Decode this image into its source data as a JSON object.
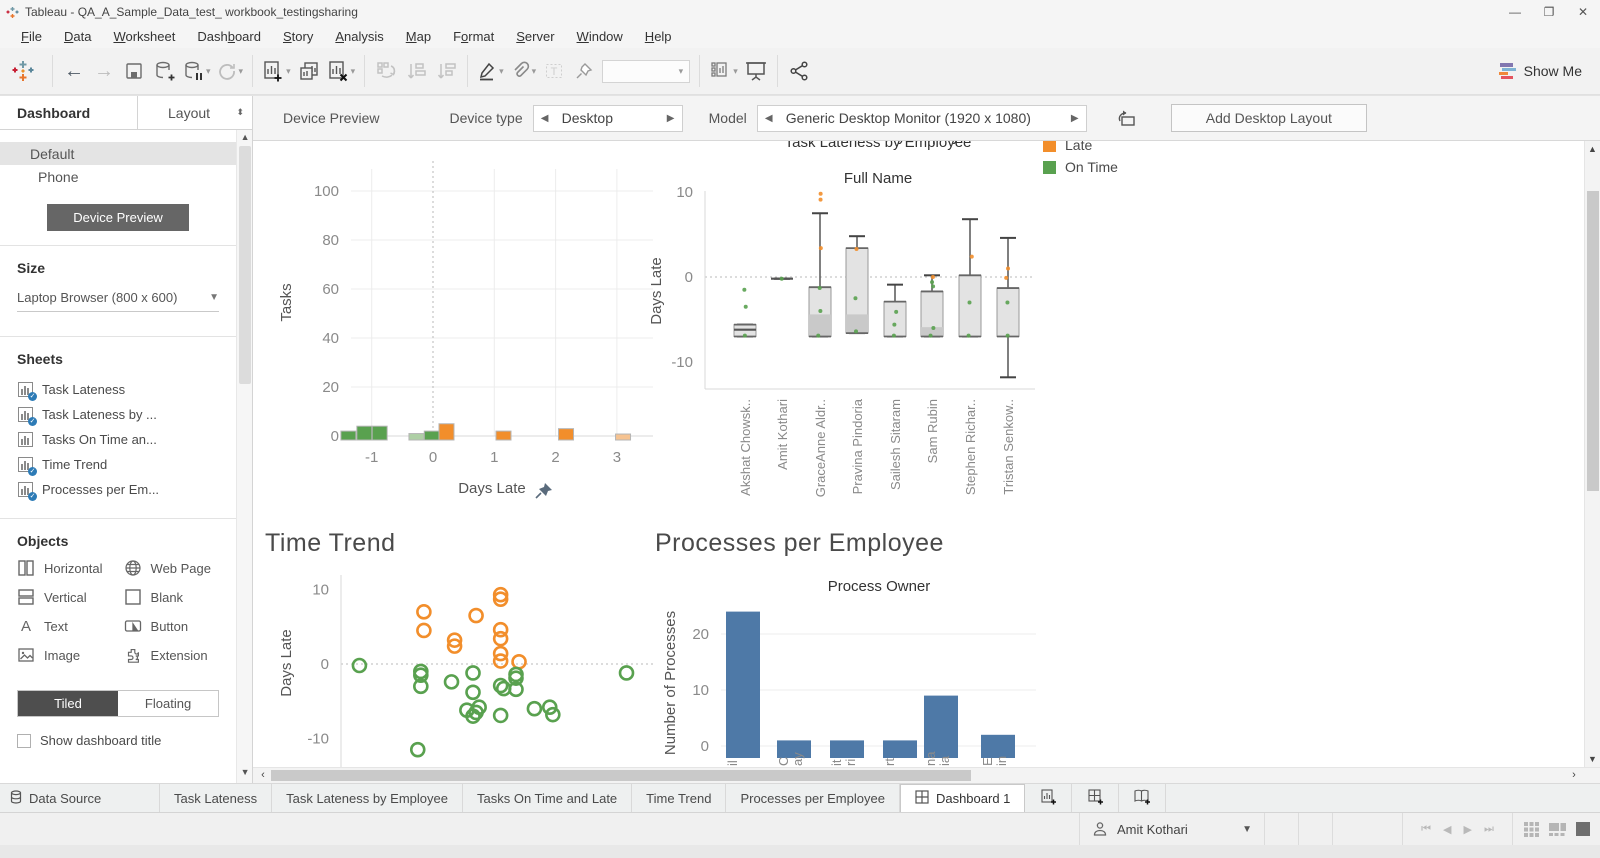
{
  "window": {
    "title": "Tableau - QA_A_Sample_Data_test_ workbook_testingsharing",
    "controls": [
      "minimize",
      "maximize",
      "close"
    ]
  },
  "menu": {
    "items": [
      {
        "label": "File",
        "u": 0
      },
      {
        "label": "Data",
        "u": 0
      },
      {
        "label": "Worksheet",
        "u": 0
      },
      {
        "label": "Dashboard",
        "u": 4
      },
      {
        "label": "Story",
        "u": 0
      },
      {
        "label": "Analysis",
        "u": 0
      },
      {
        "label": "Map",
        "u": 0
      },
      {
        "label": "Format",
        "u": 1
      },
      {
        "label": "Server",
        "u": 0
      },
      {
        "label": "Window",
        "u": 0
      },
      {
        "label": "Help",
        "u": 0
      }
    ]
  },
  "toolbar": {
    "show_me_label": "Show Me"
  },
  "sidebar": {
    "tabs": {
      "dashboard": "Dashboard",
      "layout": "Layout"
    },
    "device_list": [
      {
        "label": "Default",
        "selected": true
      },
      {
        "label": "Phone",
        "selected": false
      }
    ],
    "device_preview_button": "Device Preview",
    "size": {
      "label": "Size",
      "value": "Laptop Browser (800 x 600)"
    },
    "sheets": {
      "label": "Sheets",
      "items": [
        {
          "label": "Task Lateness",
          "in_dashboard": true
        },
        {
          "label": "Task Lateness by ...",
          "in_dashboard": true
        },
        {
          "label": "Tasks On Time an...",
          "in_dashboard": false
        },
        {
          "label": "Time Trend",
          "in_dashboard": true
        },
        {
          "label": "Processes per Em...",
          "in_dashboard": true
        }
      ]
    },
    "objects": {
      "label": "Objects",
      "items": [
        {
          "label": "Horizontal",
          "icon": "horizontal-icon"
        },
        {
          "label": "Web Page",
          "icon": "web-page-icon"
        },
        {
          "label": "Vertical",
          "icon": "vertical-icon"
        },
        {
          "label": "Blank",
          "icon": "blank-icon"
        },
        {
          "label": "Text",
          "icon": "text-icon"
        },
        {
          "label": "Button",
          "icon": "button-icon"
        },
        {
          "label": "Image",
          "icon": "image-icon"
        },
        {
          "label": "Extension",
          "icon": "extension-icon"
        }
      ]
    },
    "layout_mode": {
      "tiled": "Tiled",
      "floating": "Floating",
      "active": "Tiled"
    },
    "show_dashboard_title": {
      "label": "Show dashboard title",
      "checked": false
    }
  },
  "devicebar": {
    "preview_label": "Device Preview",
    "device_type_label": "Device type",
    "device_type_value": "Desktop",
    "model_label": "Model",
    "model_value": "Generic Desktop Monitor (1920 x 1080)",
    "add_layout_button": "Add Desktop Layout"
  },
  "legend": {
    "items": [
      {
        "label": "Late",
        "color": "#f28e2b"
      },
      {
        "label": "On Time",
        "color": "#59a14f"
      }
    ]
  },
  "chart_data": [
    {
      "type": "bar",
      "name": "Tasks On Time and Late",
      "xlabel": "Days Late",
      "ylabel": "Tasks",
      "x_ticks": [
        -1,
        0,
        1,
        2,
        3
      ],
      "y_ticks": [
        0,
        20,
        40,
        60,
        80,
        100
      ],
      "ylim": [
        0,
        110
      ],
      "bars": [
        {
          "x": -1.38,
          "value": 2,
          "color": "#59a14f"
        },
        {
          "x": -1.12,
          "value": 4,
          "color": "#59a14f"
        },
        {
          "x": -0.87,
          "value": 4,
          "color": "#59a14f"
        },
        {
          "x": -0.27,
          "value": 1,
          "color": "#aecfa5"
        },
        {
          "x": -0.02,
          "value": 2,
          "color": "#59a14f"
        },
        {
          "x": 0.22,
          "value": 5,
          "color": "#f28e2b"
        },
        {
          "x": 1.15,
          "value": 2,
          "color": "#f28e2b"
        },
        {
          "x": 2.17,
          "value": 3,
          "color": "#f28e2b"
        },
        {
          "x": 3.1,
          "value": 0.8,
          "color": "#f6c391"
        }
      ]
    },
    {
      "type": "boxplot",
      "name": "Task Lateness by Employee",
      "title_clipped": "Task Lateness by Employee",
      "column_header": "Full Name",
      "ylabel": "Days Late",
      "y_ticks": [
        10,
        0,
        -10
      ],
      "categories": [
        "Akshat Chowsk..",
        "Amit Kothari",
        "GraceAnne Aldr..",
        "Pravina Pindoria",
        "Sailesh Sitaram",
        "Sam Rubin",
        "Stephen Richar..",
        "Tristan Senkow.."
      ],
      "boxes": [
        {
          "lo": -7,
          "q1": -7,
          "q3": -5.6,
          "hi": -5.6,
          "median": -6.2,
          "points": [
            {
              "v": -1.5,
              "c": "g"
            },
            {
              "v": -3.5,
              "c": "g"
            },
            {
              "v": -6.9,
              "c": "g"
            }
          ]
        },
        {
          "lo": -0.2,
          "q1": -0.2,
          "q3": -0.2,
          "hi": -0.2,
          "median": -0.2,
          "points": [
            {
              "v": -0.2,
              "c": "g"
            }
          ]
        },
        {
          "lo": -7,
          "q1": -7,
          "q3": -1.2,
          "hi": 7.5,
          "shade": [
            -4.4,
            -7
          ],
          "points": [
            {
              "v": 9.8,
              "c": "o"
            },
            {
              "v": 9.1,
              "c": "o"
            },
            {
              "v": 3.4,
              "c": "o"
            },
            {
              "v": -1.3,
              "c": "g"
            },
            {
              "v": -4,
              "c": "g"
            },
            {
              "v": -6.9,
              "c": "g"
            }
          ]
        },
        {
          "lo": -6.6,
          "q1": -6.6,
          "q3": 3.4,
          "hi": 4.8,
          "shade": [
            -4.4,
            -6.6
          ],
          "points": [
            {
              "v": 3.3,
              "c": "o"
            },
            {
              "v": -2.5,
              "c": "g"
            },
            {
              "v": -6.4,
              "c": "g"
            }
          ]
        },
        {
          "lo": -7,
          "q1": -7,
          "q3": -2.9,
          "hi": -0.9,
          "points": [
            {
              "v": -4.1,
              "c": "g"
            },
            {
              "v": -5.6,
              "c": "g"
            },
            {
              "v": -6.9,
              "c": "g"
            }
          ]
        },
        {
          "lo": -7,
          "q1": -7,
          "q3": -1.7,
          "hi": 0.2,
          "shade": [
            -5.9,
            -7
          ],
          "points": [
            {
              "v": 0,
              "c": "o"
            },
            {
              "v": -0.6,
              "c": "g"
            },
            {
              "v": -1.1,
              "c": "g"
            },
            {
              "v": -6,
              "c": "g"
            },
            {
              "v": -6.9,
              "c": "g"
            }
          ]
        },
        {
          "lo": -7,
          "q1": -7,
          "q3": 0.2,
          "hi": 6.8,
          "points": [
            {
              "v": 2.4,
              "c": "o"
            },
            {
              "v": -3,
              "c": "g"
            },
            {
              "v": -6.9,
              "c": "g"
            }
          ]
        },
        {
          "lo": -11.8,
          "q1": -7,
          "q3": -1.3,
          "hi": 4.6,
          "points": [
            {
              "v": 1,
              "c": "o"
            },
            {
              "v": -0.1,
              "c": "o"
            },
            {
              "v": -3,
              "c": "g"
            },
            {
              "v": -6.9,
              "c": "g"
            }
          ]
        }
      ]
    },
    {
      "type": "scatter",
      "name": "Time Trend",
      "title": "Time Trend",
      "ylabel": "Days Late",
      "y_ticks": [
        10,
        0,
        -10
      ],
      "series": [
        {
          "name": "Late",
          "color": "#f28e2b",
          "points": [
            [
              0.27,
              7
            ],
            [
              0.27,
              4.5
            ],
            [
              0.37,
              3.2
            ],
            [
              0.37,
              2.4
            ],
            [
              0.44,
              6.5
            ],
            [
              0.52,
              9.3
            ],
            [
              0.52,
              8.7
            ],
            [
              0.52,
              4.6
            ],
            [
              0.52,
              3.4
            ],
            [
              0.52,
              1.4
            ],
            [
              0.52,
              0.4
            ],
            [
              0.58,
              0.3
            ]
          ]
        },
        {
          "name": "On Time",
          "color": "#59a14f",
          "points": [
            [
              0.06,
              -0.2
            ],
            [
              0.26,
              -1
            ],
            [
              0.26,
              -1.5
            ],
            [
              0.26,
              -3
            ],
            [
              0.36,
              -2.4
            ],
            [
              0.43,
              -1.2
            ],
            [
              0.43,
              -3.8
            ],
            [
              0.41,
              -6.2
            ],
            [
              0.43,
              -7
            ],
            [
              0.45,
              -5.8
            ],
            [
              0.44,
              -6.5
            ],
            [
              0.25,
              -11.5
            ],
            [
              0.52,
              -2.9
            ],
            [
              0.53,
              -3.3
            ],
            [
              0.52,
              -6.9
            ],
            [
              0.57,
              -1.4
            ],
            [
              0.57,
              -1.9
            ],
            [
              0.57,
              -3.4
            ],
            [
              0.63,
              -6
            ],
            [
              0.68,
              -5.8
            ],
            [
              0.69,
              -6.8
            ],
            [
              0.93,
              -1.2
            ]
          ]
        }
      ]
    },
    {
      "type": "bar",
      "name": "Processes per Employee",
      "title": "Processes per Employee",
      "column_header": "Process Owner",
      "ylabel": "Number of Processes",
      "y_ticks": [
        0,
        10,
        20
      ],
      "values": [
        24,
        1,
        1,
        1,
        9,
        2
      ],
      "bar_color": "#4e79a7",
      "x_label_fragments": [
        [
          "il"
        ],
        [
          "C",
          "ay"
        ],
        [
          "it",
          "ri"
        ],
        [
          "rt"
        ],
        [
          "na",
          "ia"
        ],
        [
          "E",
          "in"
        ]
      ]
    }
  ],
  "tabbar": {
    "data_source_label": "Data Source",
    "sheet_tabs": [
      "Task Lateness",
      "Task Lateness by Employee",
      "Tasks On Time and Late",
      "Time Trend",
      "Processes per Employee"
    ],
    "active_tab": "Dashboard 1"
  },
  "statusbar": {
    "user": "Amit Kothari"
  },
  "colors": {
    "late": "#f28e2b",
    "on_time": "#59a14f",
    "bar_blue": "#4e79a7",
    "dark_button": "#666666"
  }
}
